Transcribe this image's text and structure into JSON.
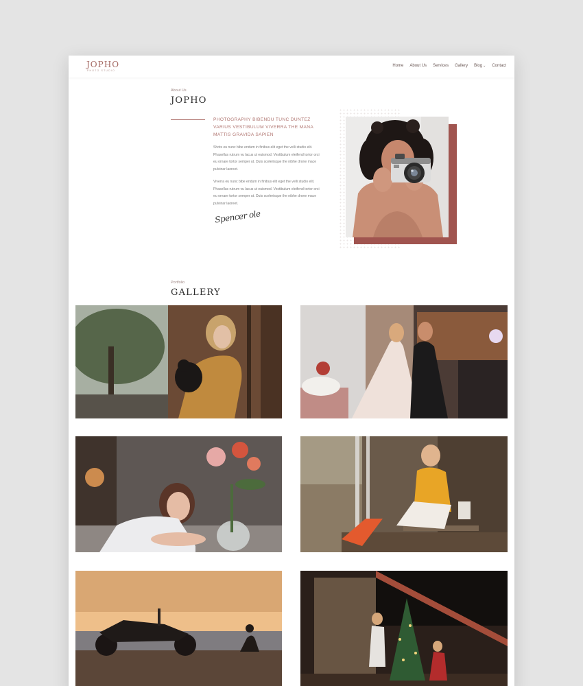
{
  "brand": {
    "name": "JOPHO",
    "tagline": "PHOTO STUDIO"
  },
  "nav": {
    "items": [
      {
        "label": "Home"
      },
      {
        "label": "About Us"
      },
      {
        "label": "Services"
      },
      {
        "label": "Gallery"
      },
      {
        "label": "Blog",
        "has_dropdown": true
      },
      {
        "label": "Contact"
      }
    ],
    "dropdown_glyph": "⌄"
  },
  "about": {
    "eyebrow": "About Us",
    "title": "JOPHO",
    "lead": "Photography bibendu tunc duntez varius vestibulum viverra the mana mattis gravida sapien",
    "paragraph_1": "Shots eu nunc bibe endum in finibus elit eget the velli studio elit. Phasellus rutrum vu lacus ut euismod. Vestibulum eleifend tortor orci eu ornare tortor semper ut. Duis scelerisque the nibhe drone mace pulvinar laoreet.",
    "paragraph_2": "Viverra eu nunc bibe endum in finibus elit eget the velli studio elit. Phasellus rutrum vu lacus ut euismod. Vestibulum eleifend tortor orci eu ornare tortor semper ut. Duis scelerisque the nibhe drone mace pulvinar laoreet.",
    "signature": "Spencer ole",
    "accent_color": "#a0544f"
  },
  "gallery": {
    "eyebrow": "Portfolio",
    "title": "GALLERY",
    "photos": [
      {
        "subject": "woman holding black cat by wooden door"
      },
      {
        "subject": "wedding couple dancing"
      },
      {
        "subject": "girl leaning on table with flowers"
      },
      {
        "subject": "girl in yellow jacket sitting on wooden porch"
      },
      {
        "subject": "motorcycle and person at sunset by the sea"
      },
      {
        "subject": "family decorating christmas tree"
      }
    ]
  }
}
